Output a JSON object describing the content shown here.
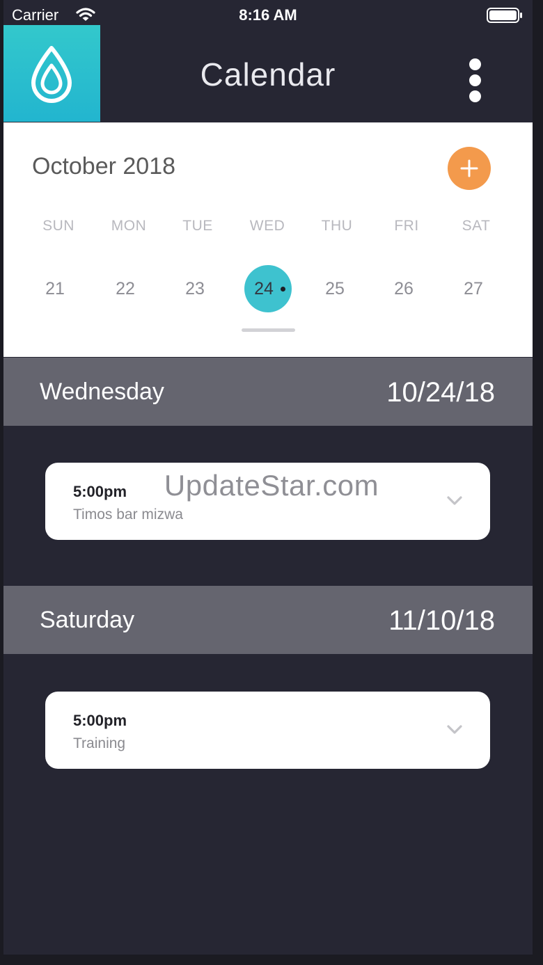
{
  "status_bar": {
    "carrier": "Carrier",
    "time": "8:16 AM"
  },
  "header": {
    "title": "Calendar",
    "icons": {
      "logo": "water-drop-icon",
      "menu": "vertical-dots-icon"
    }
  },
  "calendar": {
    "month": "October 2018",
    "weekdays": [
      "SUN",
      "MON",
      "TUE",
      "WED",
      "THU",
      "FRI",
      "SAT"
    ],
    "dates": [
      "21",
      "22",
      "23",
      "24",
      "25",
      "26",
      "27"
    ],
    "selected_date": "24"
  },
  "days": [
    {
      "name": "Wednesday",
      "date": "10/24/18",
      "events": [
        {
          "time": "5:00pm",
          "title": "Timos bar mizwa"
        }
      ]
    },
    {
      "name": "Saturday",
      "date": "11/10/18",
      "events": [
        {
          "time": "5:00pm",
          "title": "Training"
        }
      ]
    }
  ],
  "watermark": "UpdateStar.com",
  "colors": {
    "accent_teal": "#3ec2cf",
    "accent_orange": "#f39a4c",
    "background": "#262633",
    "day_header": "#65656f"
  }
}
